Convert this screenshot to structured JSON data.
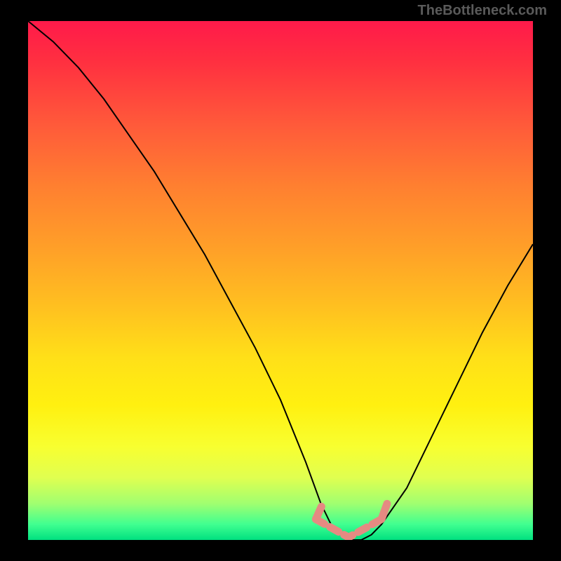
{
  "watermark": "TheBottleneck.com",
  "chart_data": {
    "type": "line",
    "title": "",
    "xlabel": "",
    "ylabel": "",
    "xlim": [
      0,
      100
    ],
    "ylim": [
      0,
      100
    ],
    "series": [
      {
        "name": "bottleneck-curve",
        "x": [
          0,
          5,
          10,
          15,
          20,
          25,
          30,
          35,
          40,
          45,
          50,
          55,
          58,
          60,
          62,
          64,
          66,
          68,
          70,
          75,
          80,
          85,
          90,
          95,
          100
        ],
        "values": [
          100,
          96,
          91,
          85,
          78,
          71,
          63,
          55,
          46,
          37,
          27,
          15,
          7,
          3,
          1,
          0,
          0,
          1,
          3,
          10,
          20,
          30,
          40,
          49,
          57
        ]
      }
    ],
    "annotations": [
      {
        "name": "valley-marker-left",
        "x": 57,
        "y": 4
      },
      {
        "name": "valley-marker-right",
        "x": 70,
        "y": 4
      }
    ],
    "gradient_stops": [
      {
        "pos": 0.0,
        "color": "#ff1a4a"
      },
      {
        "pos": 0.2,
        "color": "#ff5a3a"
      },
      {
        "pos": 0.45,
        "color": "#ffa028"
      },
      {
        "pos": 0.7,
        "color": "#fff010"
      },
      {
        "pos": 0.9,
        "color": "#a0ff70"
      },
      {
        "pos": 1.0,
        "color": "#00e080"
      }
    ]
  }
}
